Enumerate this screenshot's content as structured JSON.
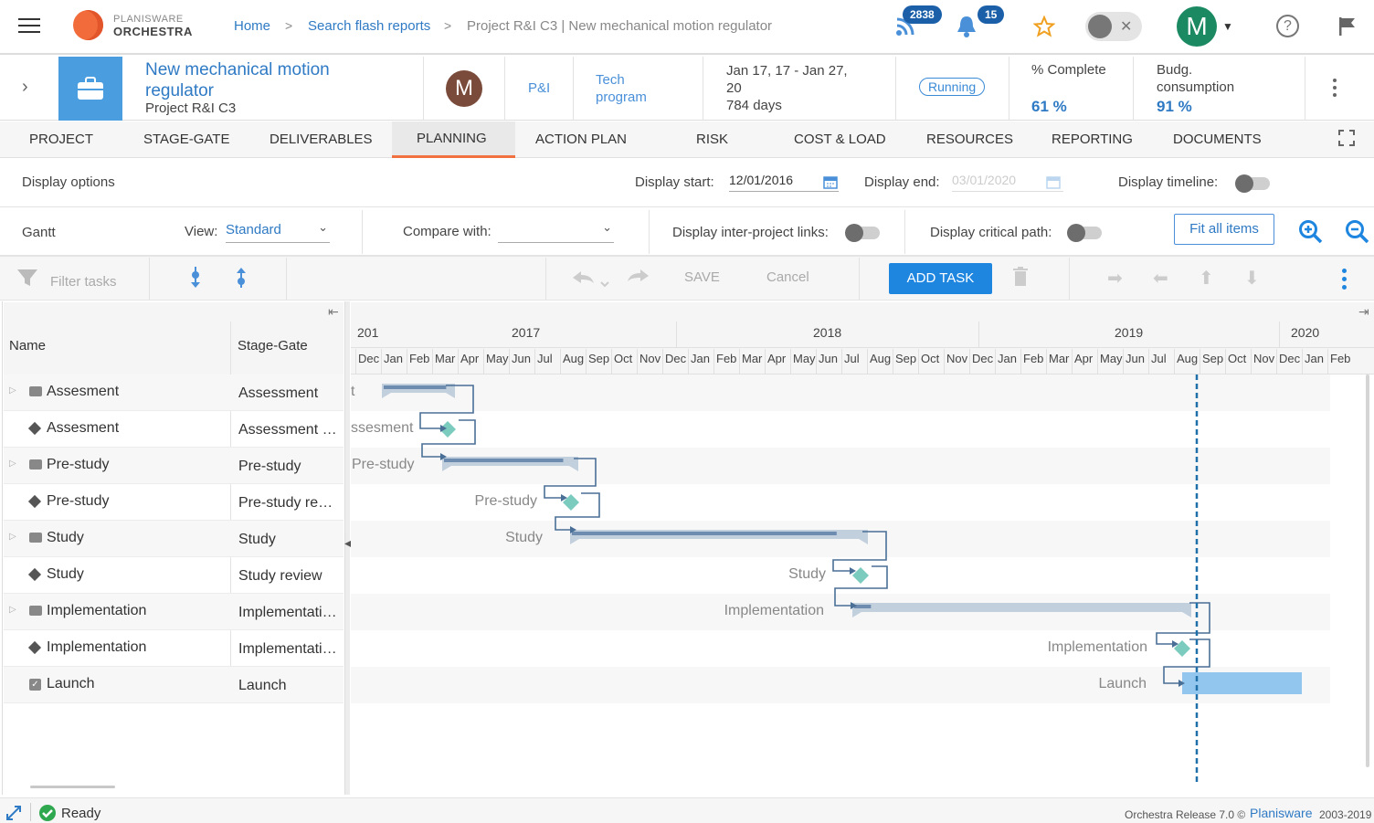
{
  "app": {
    "brand_line1": "PLANISWARE",
    "brand_line2": "ORCHESTRA"
  },
  "breadcrumb": [
    "Home",
    "Search flash reports",
    "Project R&I C3 | New mechanical motion regulator"
  ],
  "top": {
    "feed_count": "2838",
    "notif_count": "15",
    "user_initial": "M"
  },
  "project": {
    "title": "New mechanical motion regulator",
    "subtitle": "Project R&I C3",
    "owner_initial": "M",
    "category": "P&I",
    "program": "Tech program",
    "dates": "Jan 17, 17 - Jan 27, 20",
    "duration": "784 days",
    "status": "Running",
    "complete_label": "% Complete",
    "complete_value": "61 %",
    "budget_label": "Budg. consumption",
    "budget_value": "91 %"
  },
  "tabs": [
    "PROJECT",
    "STAGE-GATE",
    "DELIVERABLES",
    "PLANNING",
    "ACTION PLAN",
    "RISK",
    "COST & LOAD",
    "RESOURCES",
    "REPORTING",
    "DOCUMENTS"
  ],
  "options": {
    "display_options": "Display options",
    "display_start_label": "Display start:",
    "display_start_value": "12/01/2016",
    "display_end_label": "Display end:",
    "display_end_value": "03/01/2020",
    "display_timeline_label": "Display timeline:",
    "gantt_label": "Gantt",
    "view_label": "View:",
    "view_value": "Standard",
    "compare_label": "Compare with:",
    "interproject_label": "Display inter-project links:",
    "critical_label": "Display critical path:",
    "fit_all": "Fit all items"
  },
  "toolbar": {
    "filter_placeholder": "Filter tasks",
    "save": "SAVE",
    "cancel": "Cancel",
    "add_task": "ADD TASK"
  },
  "grid": {
    "col_name": "Name",
    "col_stage": "Stage-Gate",
    "rows": [
      {
        "name": "Assesment",
        "stage": "Assessment",
        "type": "phase"
      },
      {
        "name": "Assesment",
        "stage": "Assessment review",
        "type": "milestone"
      },
      {
        "name": "Pre-study",
        "stage": "Pre-study",
        "type": "phase"
      },
      {
        "name": "Pre-study",
        "stage": "Pre-study review",
        "type": "milestone"
      },
      {
        "name": "Study",
        "stage": "Study",
        "type": "phase"
      },
      {
        "name": "Study",
        "stage": "Study review",
        "type": "milestone"
      },
      {
        "name": "Implementation",
        "stage": "Implementation",
        "type": "phase"
      },
      {
        "name": "Implementation",
        "stage": "Implementation review",
        "type": "milestone"
      },
      {
        "name": "Launch",
        "stage": "Launch",
        "type": "task"
      }
    ]
  },
  "timeline": {
    "years": [
      "201",
      "2017",
      "2018",
      "2019",
      "2020"
    ],
    "months": [
      "Dec",
      "Jan",
      "Feb",
      "Mar",
      "Apr",
      "May",
      "Jun",
      "Jul",
      "Aug",
      "Sep",
      "Oct",
      "Nov",
      "Dec",
      "Jan",
      "Feb",
      "Mar",
      "Apr",
      "May",
      "Jun",
      "Jul",
      "Aug",
      "Sep",
      "Oct",
      "Nov",
      "Dec",
      "Jan",
      "Feb",
      "Mar",
      "Apr",
      "May",
      "Jun",
      "Jul",
      "Aug",
      "Sep",
      "Oct",
      "Nov",
      "Dec",
      "Jan",
      "Feb"
    ],
    "bar_labels": [
      "t",
      "ssesment",
      "Pre-study",
      "Pre-study",
      "Study",
      "Study",
      "Implementation",
      "Implementation",
      "Launch"
    ]
  },
  "status": {
    "ready": "Ready",
    "release": "Orchestra Release 7.0 ©",
    "vendor": "Planisware",
    "years": "2003-2019"
  },
  "colors": {
    "accent": "#2f7ac4",
    "tab_active": "#f0703f",
    "add_task": "#1f86e0",
    "milestone": "#7ccbbf",
    "bar": "#c2cfdc",
    "today_line": "#1f6fa8"
  }
}
